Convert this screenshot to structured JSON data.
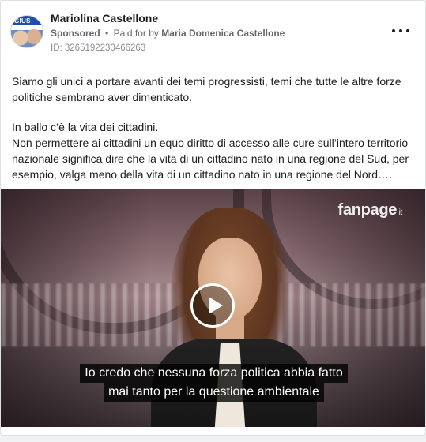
{
  "post": {
    "page_name": "Mariolina Castellone",
    "sponsored_label": "Sponsored",
    "separator": "•",
    "paid_for_prefix": "Paid for by",
    "paid_for_name": "Maria Domenica Castellone",
    "ad_id": "ID: 3265192230466263",
    "avatar_text": "GIUS",
    "body": {
      "paragraph1": "Siamo gli unici a portare avanti dei temi progressisti, temi che tutte le altre forze politiche sembrano aver dimenticato.",
      "paragraph2": "In ballo c’è la vita dei cittadini.",
      "paragraph3": "Non permettere ai cittadini un equo diritto di accesso alle cure sull’intero territorio nazionale significa dire che la vita di un cittadino nato in una regione del Sud, per esempio, valga meno della vita di un cittadino nato in una regione del Nord…."
    }
  },
  "video": {
    "watermark": "fanpage",
    "watermark_suffix": ".it",
    "subtitle_line1": "Io credo che nessuna forza politica abbia fatto",
    "subtitle_line2": "mai tanto per la questione ambientale"
  }
}
